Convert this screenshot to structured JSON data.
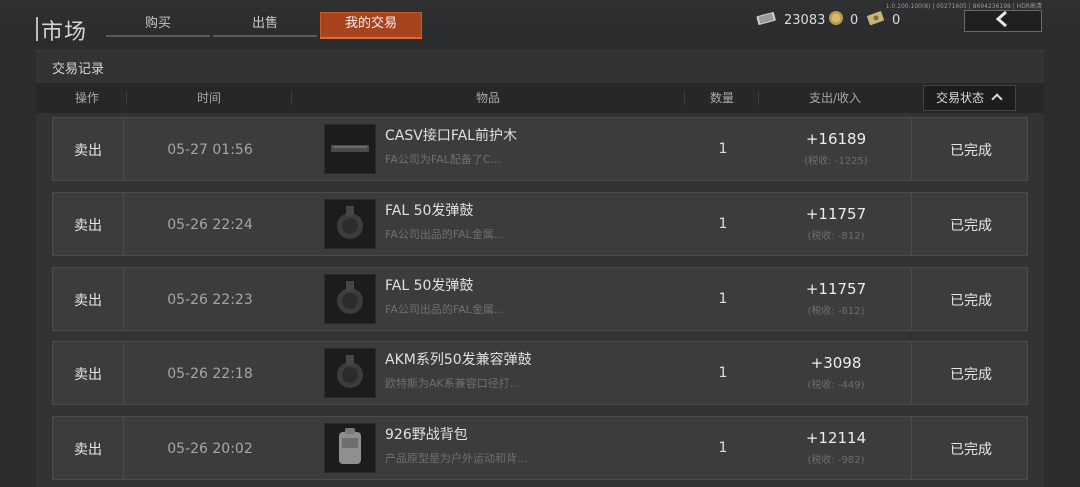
{
  "app": {
    "title": "市场",
    "version": "1.0.100.100(8) | 05271605 | 8694236198 | HDR高清"
  },
  "tabs": [
    {
      "label": "购买",
      "active": false
    },
    {
      "label": "出售",
      "active": false
    },
    {
      "label": "我的交易",
      "active": true
    }
  ],
  "currency": [
    {
      "icon": "cash-icon",
      "value": "23083"
    },
    {
      "icon": "coin-icon",
      "value": "0"
    },
    {
      "icon": "voucher-icon",
      "value": "0"
    }
  ],
  "section_title": "交易记录",
  "columns": {
    "op": "操作",
    "time": "时间",
    "item": "物品",
    "qty": "数量",
    "amount": "支出/收入",
    "status": "交易状态"
  },
  "rows": [
    {
      "op": "卖出",
      "time": "05-27 01:56",
      "name": "CASV接口FAL前护木",
      "desc": "FA公司为FAL配备了C...",
      "qty": "1",
      "amount": "+16189",
      "tax": "(税收: -1225)",
      "status": "已完成",
      "thumb": "handguard-icon"
    },
    {
      "op": "卖出",
      "time": "05-26 22:24",
      "name": "FAL 50发弹鼓",
      "desc": "FA公司出品的FAL金属...",
      "qty": "1",
      "amount": "+11757",
      "tax": "(税收: -812)",
      "status": "已完成",
      "thumb": "drum-magazine-icon"
    },
    {
      "op": "卖出",
      "time": "05-26 22:23",
      "name": "FAL 50发弹鼓",
      "desc": "FA公司出品的FAL金属...",
      "qty": "1",
      "amount": "+11757",
      "tax": "(税收: -812)",
      "status": "已完成",
      "thumb": "drum-magazine-icon"
    },
    {
      "op": "卖出",
      "time": "05-26 22:18",
      "name": "AKM系列50发兼容弹鼓",
      "desc": "欧特斯为AK系兼容口径打...",
      "qty": "1",
      "amount": "+3098",
      "tax": "(税收: -449)",
      "status": "已完成",
      "thumb": "drum-magazine-icon"
    },
    {
      "op": "卖出",
      "time": "05-26 20:02",
      "name": "926野战背包",
      "desc": "产品原型是为户外运动和背...",
      "qty": "1",
      "amount": "+12114",
      "tax": "(税收: -982)",
      "status": "已完成",
      "thumb": "backpack-icon"
    }
  ]
}
